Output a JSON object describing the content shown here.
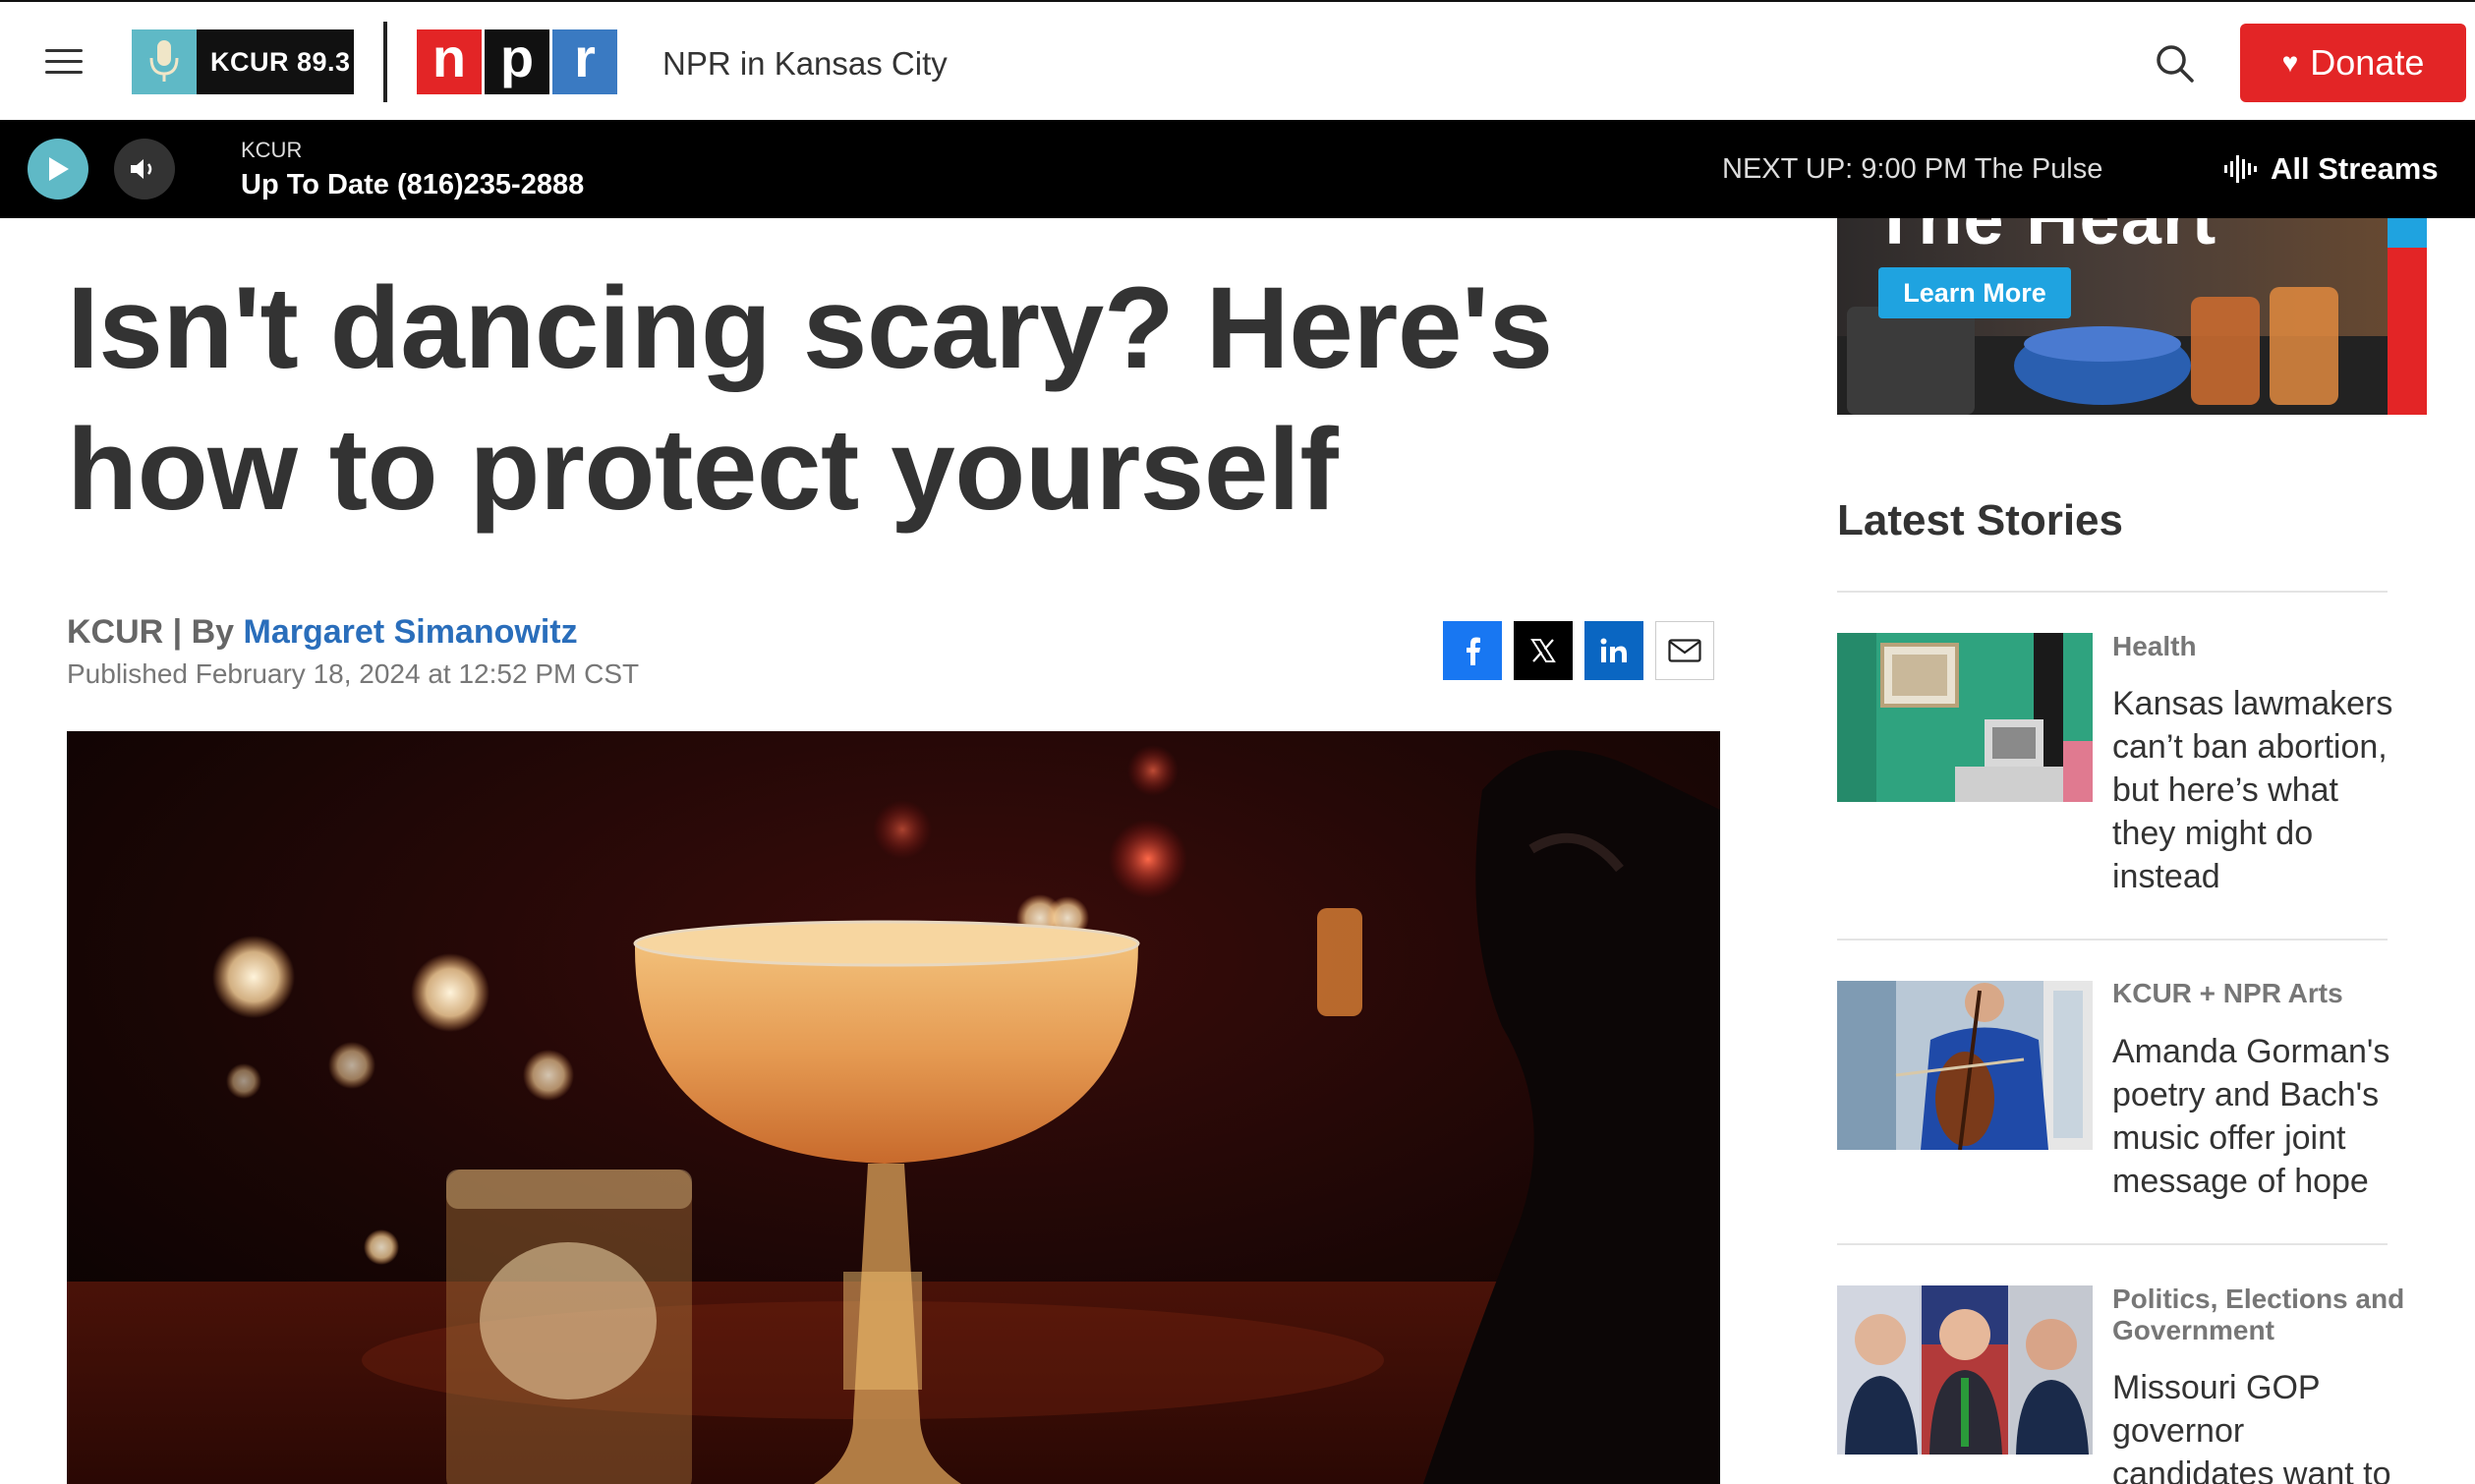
{
  "header": {
    "kcur_logo_text": "KCUR 89.3",
    "npr_letters": [
      "n",
      "p",
      "r"
    ],
    "station_name": "NPR in Kansas City",
    "donate_label": "Donate"
  },
  "player": {
    "station": "KCUR",
    "show": "Up To Date (816)235-2888",
    "next_up": "NEXT UP: 9:00 PM The Pulse",
    "all_streams_label": "All Streams"
  },
  "article": {
    "headline": "Isn't dancing scary? Here's how to protect yourself",
    "source": "KCUR | By ",
    "author": "Margaret Simanowitz",
    "published": "Published February 18, 2024 at 12:52 PM CST"
  },
  "sidebar": {
    "ad": {
      "headline_fragment": "The Heart",
      "button_label": "Learn More"
    },
    "latest_title": "Latest Stories",
    "stories": [
      {
        "category": "Health",
        "title": "Kansas lawmakers can’t ban abortion, but here’s what they might do instead"
      },
      {
        "category": "KCUR + NPR Arts",
        "title": "Amanda Gorman's poetry and Bach's music offer joint message of hope"
      },
      {
        "category": "Politics, Elections and Government",
        "title": "Missouri GOP governor candidates want to"
      }
    ]
  },
  "colors": {
    "npr_red": "#e32526",
    "npr_blue": "#3a7ac2",
    "kcur_teal": "#5fb9c6",
    "link_blue": "#2a6ebb"
  }
}
